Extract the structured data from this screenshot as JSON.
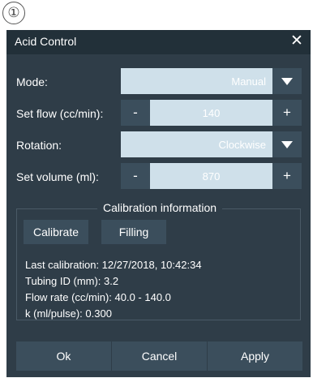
{
  "marker": "①",
  "dialog": {
    "title": "Acid Control",
    "close_icon": "close-icon"
  },
  "fields": {
    "mode": {
      "label": "Mode:",
      "value": "Manual"
    },
    "set_flow": {
      "label": "Set flow (cc/min):",
      "value": "140",
      "minus": "-",
      "plus": "+"
    },
    "rotation": {
      "label": "Rotation:",
      "value": "Clockwise"
    },
    "set_volume": {
      "label": "Set volume (ml):",
      "value": "870",
      "minus": "-",
      "plus": "+"
    }
  },
  "calibration": {
    "title": "Calibration information",
    "calibrate_label": "Calibrate",
    "filling_label": "Filling",
    "last_calibration": "Last calibration: 12/27/2018, 10:42:34",
    "tubing_id": "Tubing ID (mm): 3.2",
    "flow_rate": "Flow rate (cc/min): 40.0 - 140.0",
    "k_value": "k (ml/pulse): 0.300"
  },
  "footer": {
    "ok_label": "Ok",
    "cancel_label": "Cancel",
    "apply_label": "Apply"
  },
  "colors": {
    "dialog_bg": "#2f3d48",
    "titlebar_bg": "#223039",
    "button_bg": "#3b4e5c",
    "field_bg": "#cfe0ea"
  }
}
